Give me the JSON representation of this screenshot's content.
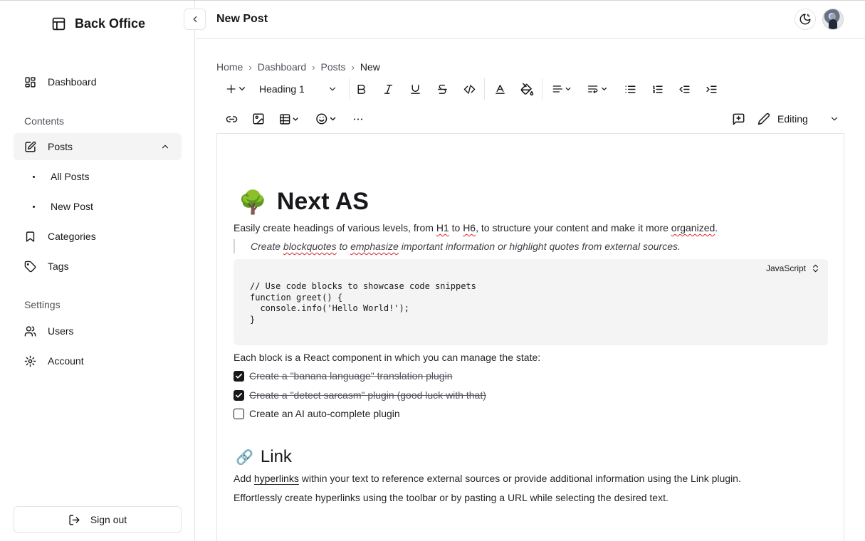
{
  "brand": {
    "title": "Back Office",
    "icon": "layout-panel-icon"
  },
  "sidebar": {
    "dashboard": "Dashboard",
    "contents_label": "Contents",
    "posts": "Posts",
    "posts_sub": [
      "All Posts",
      "New Post"
    ],
    "categories": "Categories",
    "tags": "Tags",
    "settings_label": "Settings",
    "users": "Users",
    "account": "Account",
    "sign_out": "Sign out"
  },
  "header": {
    "title": "New Post"
  },
  "breadcrumb": [
    "Home",
    "Dashboard",
    "Posts",
    "New"
  ],
  "toolbar": {
    "heading_value": "Heading 1",
    "mode": "Editing"
  },
  "editor": {
    "h1_emoji": "🌳",
    "h1": "Next AS",
    "intro": {
      "a": "Easily create headings of various levels, from ",
      "h1": "H1",
      "b": " to ",
      "h6": "H6",
      "c": ", to structure your content and make it more ",
      "organized": "organized",
      "d": "."
    },
    "quote": {
      "a": "Create ",
      "blockquotes": "blockquotes",
      "b": " to ",
      "emphasize": "emphasize",
      "c": " important information or highlight quotes from external sources."
    },
    "code_lang": "JavaScript",
    "code": "// Use code blocks to showcase code snippets\nfunction greet() {\n  console.info('Hello World!');\n}",
    "state_text": "Each block is a React component in which you can manage the state:",
    "todos": [
      {
        "text": "Create a \"banana language\" translation plugin",
        "checked": true
      },
      {
        "text": "Create a \"detect sarcasm\" plugin (good luck with that)",
        "checked": true
      },
      {
        "text": "Create an AI auto-complete plugin",
        "checked": false
      }
    ],
    "h2_emoji": "🔗",
    "h2": "Link",
    "link_para": {
      "a": "Add ",
      "link": "hyperlinks",
      "b": " within your text to reference external sources or provide additional information using the Link plugin."
    },
    "link_para2": "Effortlessly create hyperlinks using the toolbar or by pasting a URL while selecting the desired text."
  }
}
